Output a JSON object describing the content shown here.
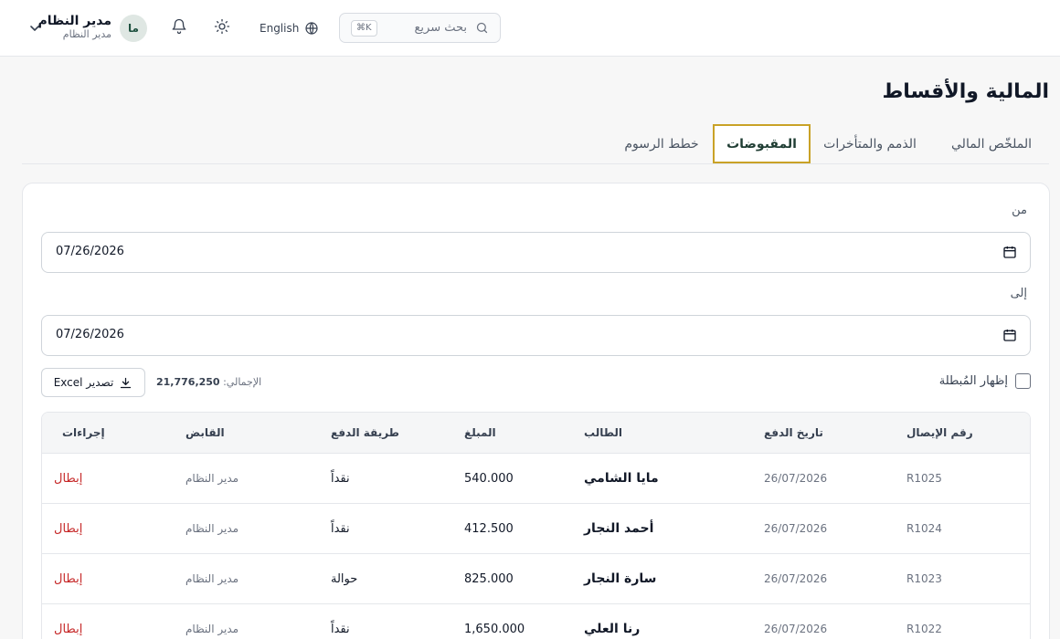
{
  "header": {
    "user_name": "مدير النظام",
    "user_role": "مدير النظام",
    "avatar_initials": "ما",
    "language_label": "English",
    "search_placeholder": "بحث سريع",
    "search_shortcut": "⌘K"
  },
  "page": {
    "title": "المالية والأقساط"
  },
  "tabs": [
    {
      "label": "الملخّص المالي",
      "active": false
    },
    {
      "label": "الذمم والمتأخرات",
      "active": false
    },
    {
      "label": "المقبوضات",
      "active": true
    },
    {
      "label": "خطط الرسوم",
      "active": false
    }
  ],
  "filters": {
    "from_label": "من",
    "from_value": "07/26/2026",
    "to_label": "إلى",
    "to_value": "07/26/2026",
    "show_voided_label": "إظهار المُبطلة",
    "show_voided_checked": false,
    "total_label": "الإجمالي:",
    "total_value": "21,776,250",
    "export_label": "تصدير Excel"
  },
  "table": {
    "columns": {
      "receipt": "رقم الإيصال",
      "date": "تاريخ الدفع",
      "student": "الطالب",
      "amount": "المبلغ",
      "method": "طريقة الدفع",
      "collector": "القابض",
      "actions": "إجراءات"
    },
    "rows": [
      {
        "receipt": "R1025",
        "date": "26/07/2026",
        "student": "مايا الشامي",
        "amount": "540.000",
        "method": "نقداً",
        "collector": "مدير النظام",
        "action": "إبطال"
      },
      {
        "receipt": "R1024",
        "date": "26/07/2026",
        "student": "أحمد النجار",
        "amount": "412.500",
        "method": "نقداً",
        "collector": "مدير النظام",
        "action": "إبطال"
      },
      {
        "receipt": "R1023",
        "date": "26/07/2026",
        "student": "سارة النجار",
        "amount": "825.000",
        "method": "حوالة",
        "collector": "مدير النظام",
        "action": "إبطال"
      },
      {
        "receipt": "R1022",
        "date": "26/07/2026",
        "student": "رنا العلي",
        "amount": "1,650.000",
        "method": "نقداً",
        "collector": "مدير النظام",
        "action": "إبطال"
      }
    ]
  },
  "colors": {
    "accent_gold": "#c9a227",
    "void_red": "#c62828",
    "avatar_bg": "#dfe7e3"
  }
}
